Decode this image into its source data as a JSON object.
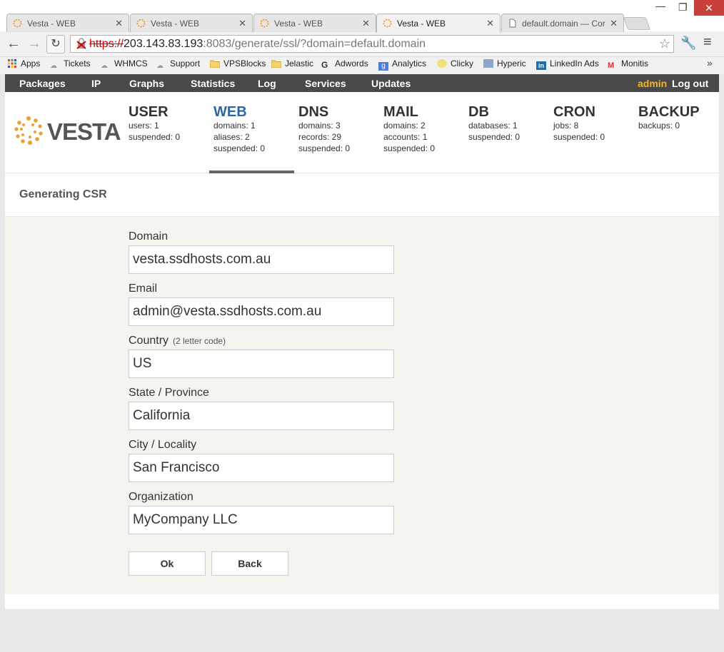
{
  "browser": {
    "tabs": [
      {
        "title": "Vesta - WEB"
      },
      {
        "title": "Vesta - WEB"
      },
      {
        "title": "Vesta - WEB"
      },
      {
        "title": "Vesta - WEB"
      },
      {
        "title": "default.domain — Cor"
      }
    ],
    "url_scheme": "https://",
    "url_host": "203.143.83.193",
    "url_rest": ":8083/generate/ssl/?domain=default.domain",
    "bookmarks": [
      "Apps",
      "Tickets",
      "WHMCS",
      "Support",
      "VPSBlocks",
      "Jelastic",
      "Adwords",
      "Analytics",
      "Clicky",
      "Hyperic",
      "LinkedIn Ads",
      "Monitis"
    ]
  },
  "topnav": {
    "items": [
      "Packages",
      "IP",
      "Graphs",
      "Statistics",
      "Log",
      "Services",
      "Updates"
    ],
    "user": "admin",
    "logout": "Log out"
  },
  "logo": "VESTA",
  "sections": [
    {
      "title": "USER",
      "lines": [
        "users: 1",
        "suspended: 0"
      ]
    },
    {
      "title": "WEB",
      "lines": [
        "domains: 1",
        "aliases: 2",
        "suspended: 0"
      ]
    },
    {
      "title": "DNS",
      "lines": [
        "domains: 3",
        "records: 29",
        "suspended: 0"
      ]
    },
    {
      "title": "MAIL",
      "lines": [
        "domains: 2",
        "accounts: 1",
        "suspended: 0"
      ]
    },
    {
      "title": "DB",
      "lines": [
        "databases: 1",
        "suspended: 0"
      ]
    },
    {
      "title": "CRON",
      "lines": [
        "jobs: 8",
        "suspended: 0"
      ]
    },
    {
      "title": "BACKUP",
      "lines": [
        "backups: 0"
      ]
    }
  ],
  "page_title": "Generating CSR",
  "form": {
    "domain_label": "Domain",
    "domain_value": "vesta.ssdhosts.com.au",
    "email_label": "Email",
    "email_value": "admin@vesta.ssdhosts.com.au",
    "country_label": "Country",
    "country_hint": "(2 letter code)",
    "country_value": "US",
    "state_label": "State / Province",
    "state_value": "California",
    "city_label": "City / Locality",
    "city_value": "San Francisco",
    "org_label": "Organization",
    "org_value": "MyCompany LLC",
    "ok_label": "Ok",
    "back_label": "Back"
  },
  "colors": {
    "accent": "#2c67a6",
    "admin": "#f5b81c",
    "nav_bg": "#494949",
    "form_bg": "#f5f4ef"
  }
}
